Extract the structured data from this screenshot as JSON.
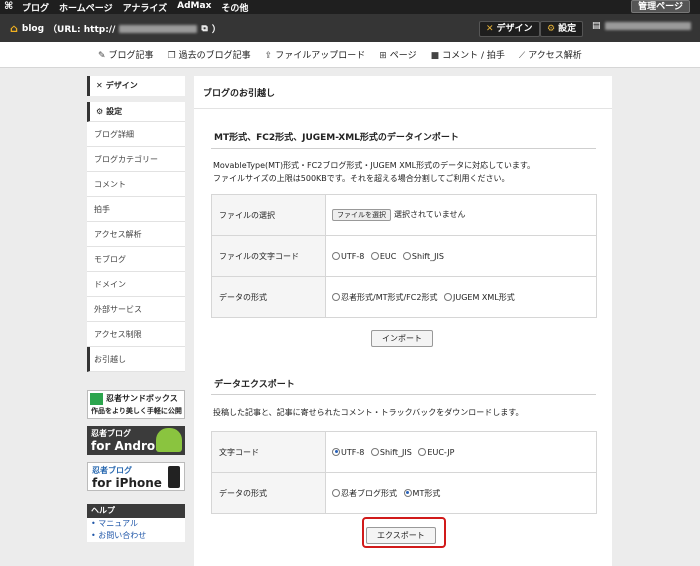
{
  "topnav": {
    "logo": "⌘",
    "links": [
      "ブログ",
      "ホームページ",
      "アナライズ",
      "AdMax",
      "その他"
    ],
    "admin_label": "管理ページ"
  },
  "blogbar": {
    "blog_label": "blog",
    "url_prefix": "（URL: http://",
    "url_suffix": "）",
    "design_label": "デザイン",
    "settings_label": "設定"
  },
  "tabs": [
    {
      "icon": "pencil-icon",
      "label": "ブログ記事"
    },
    {
      "icon": "documents-icon",
      "label": "過去のブログ記事"
    },
    {
      "icon": "upload-icon",
      "label": "ファイルアップロード"
    },
    {
      "icon": "sitemap-icon",
      "label": "ページ"
    },
    {
      "icon": "comment-icon",
      "label": "コメント / 拍手"
    },
    {
      "icon": "chart-icon",
      "label": "アクセス解析"
    }
  ],
  "sidebar": {
    "design_label": "デザイン",
    "settings_label": "設定",
    "items": [
      "ブログ詳細",
      "ブログカテゴリー",
      "コメント",
      "拍手",
      "アクセス解析",
      "モブログ",
      "ドメイン",
      "外部サービス",
      "アクセス制限",
      "お引越し"
    ],
    "banners": {
      "sandbox_title": "忍者サンドボックス",
      "sandbox_sub": "作品をより美しく手軽に公開",
      "android_title": "忍者ブログ",
      "android_sub": "for Android",
      "iphone_title": "忍者ブログ",
      "iphone_sub": "for iPhone"
    },
    "help": {
      "title": "ヘルプ",
      "items": [
        "マニュアル",
        "お問い合わせ"
      ]
    }
  },
  "main": {
    "title": "ブログのお引越し",
    "import": {
      "title": "MT形式、FC2形式、JUGEM-XML形式のデータインポート",
      "desc1": "MovableType(MT)形式・FC2ブログ形式・JUGEM XML形式のデータに対応しています。",
      "desc2": "ファイルサイズの上限は500KBです。それを超える場合分割してご利用ください。",
      "file_label": "ファイルの選択",
      "file_button": "ファイルを選択",
      "file_status": "選択されていません",
      "charset_label": "ファイルの文字コード",
      "charset_options": [
        "UTF-8",
        "EUC",
        "Shift_JIS"
      ],
      "format_label": "データの形式",
      "format_options": [
        "忍者形式/MT形式/FC2形式",
        "JUGEM XML形式"
      ],
      "button": "インポート"
    },
    "export": {
      "title": "データエクスポート",
      "desc": "投稿した記事と、記事に寄せられたコメント・トラックバックをダウンロードします。",
      "charset_label": "文字コード",
      "charset_options": [
        "UTF-8",
        "Shift_JIS",
        "EUC-JP"
      ],
      "charset_selected": "UTF-8",
      "format_label": "データの形式",
      "format_options": [
        "忍者ブログ形式",
        "MT形式"
      ],
      "format_selected": "MT形式",
      "button": "エクスポート"
    }
  },
  "colors": {
    "highlight": "#d11a1a",
    "accent": "#e8b43a"
  }
}
